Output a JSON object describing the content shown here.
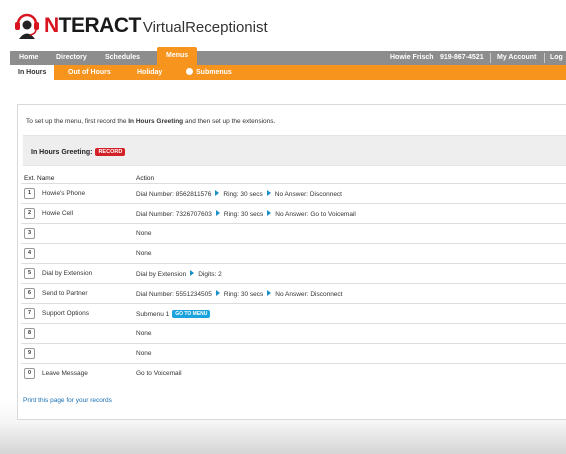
{
  "logo": {
    "brand_letter": "N",
    "brand_rest": "TERACT",
    "suffix": "VirtualReceptionist",
    "icon": "headset-person-icon"
  },
  "topnav": {
    "items": [
      "Home",
      "Directory",
      "Schedules",
      "Menus"
    ],
    "active": "Menus",
    "user": "Howie Frisch",
    "phone": "919-867-4521",
    "my_account": "My Account",
    "logout": "Log"
  },
  "subnav": {
    "items": [
      "In Hours",
      "Out of Hours",
      "Holiday",
      "Submenus"
    ],
    "active": "In Hours",
    "submenus_icon": "gear-icon"
  },
  "panel": {
    "intro_pre": "To set up the menu, first record the ",
    "intro_bold": "In Hours Greeting",
    "intro_post": " and then set up the extensions.",
    "greeting_label": "In Hours Greeting:",
    "record_label": "RECORD",
    "columns": {
      "ext_name": "Ext.  Name",
      "action": "Action"
    },
    "rows": [
      {
        "ext": "1",
        "name": "Howie's Phone",
        "action": [
          "Dial Number: 8562811576",
          "Ring: 30 secs",
          "No Answer: Disconnect"
        ]
      },
      {
        "ext": "2",
        "name": "Howie Cell",
        "action": [
          "Dial Number: 7326707603",
          "Ring: 30 secs",
          "No Answer: Go to Voicemail"
        ]
      },
      {
        "ext": "3",
        "name": "",
        "action": [
          "None"
        ]
      },
      {
        "ext": "4",
        "name": "",
        "action": [
          "None"
        ]
      },
      {
        "ext": "5",
        "name": "Dial by Extension",
        "action": [
          "Dial by Extension",
          "Digits: 2"
        ]
      },
      {
        "ext": "6",
        "name": "Send to Partner",
        "action": [
          "Dial Number: 5551234505",
          "Ring: 30 secs",
          "No Answer: Disconnect"
        ]
      },
      {
        "ext": "7",
        "name": "Support Options",
        "action": [
          "Submenu 1"
        ],
        "badge": "GO TO MENU"
      },
      {
        "ext": "8",
        "name": "",
        "action": [
          "None"
        ]
      },
      {
        "ext": "9",
        "name": "",
        "action": [
          "None"
        ]
      },
      {
        "ext": "0",
        "name": "Leave Message",
        "action": [
          "Go to Voicemail"
        ]
      }
    ],
    "print_link": "Print this page for your records"
  },
  "colors": {
    "orange": "#f7941d",
    "nav_grey": "#8d8d8d",
    "record_red": "#d32127",
    "goto_blue": "#1aa3dc",
    "arrow_blue": "#1a8fc6"
  }
}
